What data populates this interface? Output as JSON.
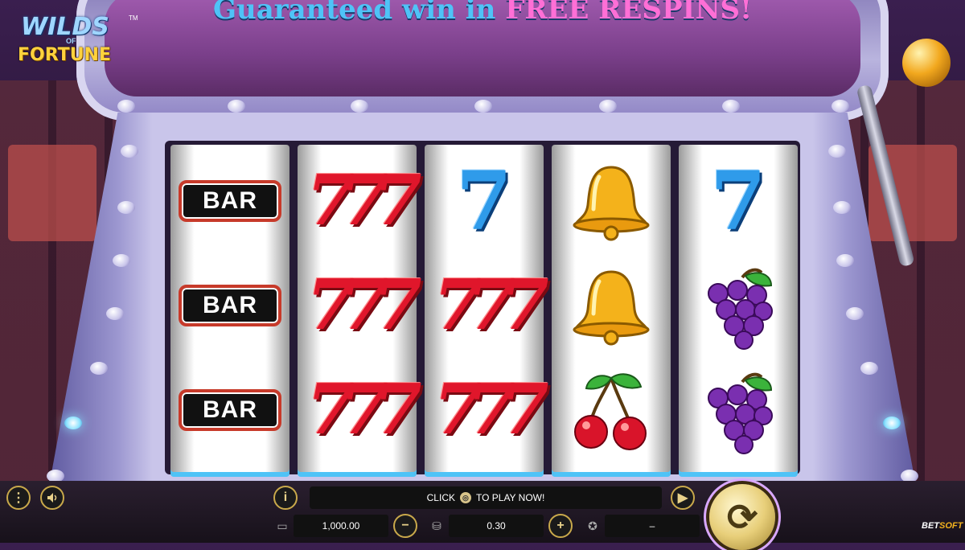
{
  "logo": {
    "line1": "WILDS",
    "line2": "OF",
    "line3": "FORTUNE",
    "tm": "TM"
  },
  "banner": {
    "text_main": "Guaranteed win in ",
    "text_highlight": "FREE RESPINS!"
  },
  "reels": [
    {
      "symbols": [
        "BAR",
        "BAR",
        "BAR"
      ]
    },
    {
      "symbols": [
        "777",
        "777",
        "777"
      ]
    },
    {
      "symbols": [
        "7",
        "777",
        "777"
      ]
    },
    {
      "symbols": [
        "bell",
        "bell",
        "cherries"
      ]
    },
    {
      "symbols": [
        "7",
        "grapes",
        "grapes"
      ]
    }
  ],
  "controls": {
    "menu_icon": "menu-icon",
    "sound_icon": "speaker-icon",
    "info_label": "i",
    "message_prefix": "CLICK",
    "message_suffix": "TO PLAY NOW!",
    "balance": "1,000.00",
    "bet": "0.30",
    "win": "–",
    "minus_label": "−",
    "plus_label": "+",
    "autoplay_icon": "autoplay-icon",
    "spin_icon": "spin-icon"
  },
  "brand": {
    "name_part1": "BET",
    "name_part2": "SOFT"
  },
  "colors": {
    "accent_gold": "#e8cf7a",
    "red_seven": "#e0162b",
    "blue_seven": "#2f9bea"
  }
}
